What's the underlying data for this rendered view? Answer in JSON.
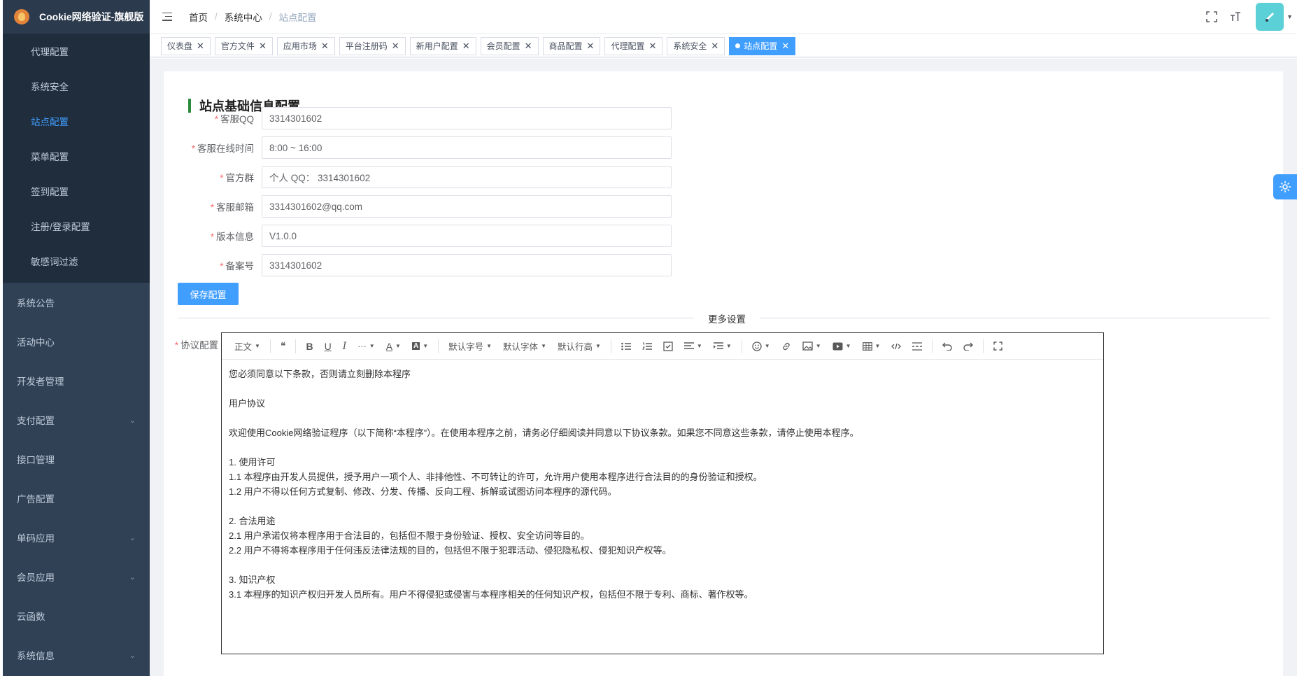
{
  "brand": {
    "title": "Cookie网络验证-旗舰版"
  },
  "sidebar": {
    "submenu": [
      {
        "label": "代理配置",
        "active": false
      },
      {
        "label": "系统安全",
        "active": false
      },
      {
        "label": "站点配置",
        "active": true
      },
      {
        "label": "菜单配置",
        "active": false
      },
      {
        "label": "签到配置",
        "active": false
      },
      {
        "label": "注册/登录配置",
        "active": false
      },
      {
        "label": "敏感词过滤",
        "active": false
      }
    ],
    "menu": [
      {
        "label": "系统公告",
        "arrow": false
      },
      {
        "label": "活动中心",
        "arrow": false
      },
      {
        "label": "开发者管理",
        "arrow": false
      },
      {
        "label": "支付配置",
        "arrow": true
      },
      {
        "label": "接口管理",
        "arrow": false
      },
      {
        "label": "广告配置",
        "arrow": false
      },
      {
        "label": "单码应用",
        "arrow": true
      },
      {
        "label": "会员应用",
        "arrow": true
      },
      {
        "label": "云函数",
        "arrow": false
      },
      {
        "label": "系统信息",
        "arrow": true
      }
    ]
  },
  "breadcrumb": [
    "首页",
    "系统中心",
    "站点配置"
  ],
  "tags": [
    {
      "label": "仪表盘",
      "active": false
    },
    {
      "label": "官方文件",
      "active": false
    },
    {
      "label": "应用市场",
      "active": false
    },
    {
      "label": "平台注册码",
      "active": false
    },
    {
      "label": "新用户配置",
      "active": false
    },
    {
      "label": "会员配置",
      "active": false
    },
    {
      "label": "商品配置",
      "active": false
    },
    {
      "label": "代理配置",
      "active": false
    },
    {
      "label": "系统安全",
      "active": false
    },
    {
      "label": "站点配置",
      "active": true
    }
  ],
  "form": {
    "title": "站点基础信息配置",
    "fields": [
      {
        "label": "客服QQ",
        "value": "3314301602"
      },
      {
        "label": "客服在线时间",
        "value": "8:00 ~ 16:00"
      },
      {
        "label": "官方群",
        "value": "个人 QQ： 3314301602"
      },
      {
        "label": "客服邮箱",
        "value": "3314301602@qq.com"
      },
      {
        "label": "版本信息",
        "value": "V1.0.0"
      },
      {
        "label": "备案号",
        "value": "3314301602"
      }
    ],
    "save_label": "保存配置",
    "divider_text": "更多设置",
    "agreement_label": "协议配置"
  },
  "editor": {
    "toolbar": {
      "paragraph": "正文",
      "font_size": "默认字号",
      "font_family": "默认字体",
      "line_height": "默认行高",
      "quote": "❝",
      "bold": "B",
      "underline": "U",
      "italic": "I",
      "more": "···",
      "color": "A",
      "bgcolor": "A"
    },
    "content": [
      "您必须同意以下条款，否则请立刻删除本程序",
      "",
      "用户协议",
      "",
      "欢迎使用Cookie网络验证程序（以下简称“本程序”）。在使用本程序之前，请务必仔细阅读并同意以下协议条款。如果您不同意这些条款，请停止使用本程序。",
      "",
      "1. 使用许可",
      "1.1 本程序由开发人员提供，授予用户一项个人、非排他性、不可转让的许可，允许用户使用本程序进行合法目的的身份验证和授权。",
      "1.2 用户不得以任何方式复制、修改、分发、传播、反向工程、拆解或试图访问本程序的源代码。",
      "",
      "2. 合法用途",
      "2.1 用户承诺仅将本程序用于合法目的，包括但不限于身份验证、授权、安全访问等目的。",
      "2.2 用户不得将本程序用于任何违反法律法规的目的，包括但不限于犯罪活动、侵犯隐私权、侵犯知识产权等。",
      "",
      "3. 知识产权",
      "3.1 本程序的知识产权归开发人员所有。用户不得侵犯或侵害与本程序相关的任何知识产权，包括但不限于专利、商标、著作权等。"
    ]
  },
  "colors": {
    "sidebar_bg": "#304156",
    "submenu_bg": "#1f2d3d",
    "accent": "#409eff",
    "title_bar": "#2c8a3e"
  }
}
